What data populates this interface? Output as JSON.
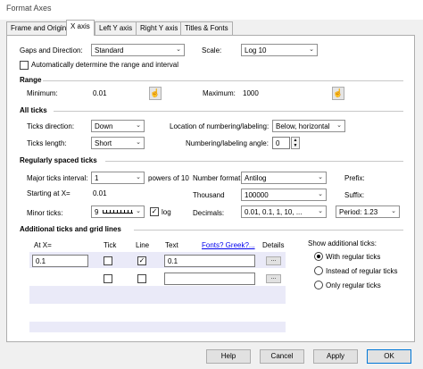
{
  "window": {
    "title": "Format Axes"
  },
  "tabs": [
    "Frame and Origin",
    "X axis",
    "Left Y axis",
    "Right Y axis",
    "Titles & Fonts"
  ],
  "gaps": {
    "label": "Gaps and Direction:",
    "value": "Standard",
    "scale_label": "Scale:",
    "scale_value": "Log 10",
    "auto_label": "Automatically determine the range and interval"
  },
  "range": {
    "title": "Range",
    "min_label": "Minimum:",
    "min_value": "0.01",
    "max_label": "Maximum:",
    "max_value": "1000"
  },
  "all_ticks": {
    "title": "All ticks",
    "dir_label": "Ticks direction:",
    "dir_value": "Down",
    "loc_label": "Location of numbering/labeling:",
    "loc_value": "Below, horizontal",
    "len_label": "Ticks length:",
    "len_value": "Short",
    "angle_label": "Numbering/labeling angle:",
    "angle_value": "0"
  },
  "regular": {
    "title": "Regularly spaced ticks",
    "major_label": "Major ticks interval:",
    "major_value": "1",
    "powers_label": "powers of 10",
    "numfmt_label": "Number format:",
    "numfmt_value": "Antilog",
    "prefix_label": "Prefix:",
    "start_label": "Starting at X=",
    "start_value": "0.01",
    "thousand_label": "Thousand",
    "thousand_value": "100000",
    "suffix_label": "Suffix:",
    "minor_label": "Minor ticks:",
    "minor_value": "9",
    "log_label": "log",
    "decimals_label": "Decimals:",
    "decimals_value": "0.01, 0.1, 1, 10, ...",
    "period_value": "Period: 1.23"
  },
  "additional": {
    "title": "Additional ticks and grid lines",
    "col_at": "At X=",
    "col_tick": "Tick",
    "col_line": "Line",
    "col_text": "Text",
    "fonts_link": "Fonts? Greek?...",
    "col_details": "Details",
    "rows": [
      {
        "at": "0.1",
        "tick": false,
        "line": true,
        "text": "0.1",
        "details": "..."
      },
      {
        "at": "",
        "tick": false,
        "line": false,
        "text": "",
        "details": "..."
      }
    ],
    "show_label": "Show additional ticks:",
    "options": [
      "With regular ticks",
      "Instead of regular ticks",
      "Only regular ticks"
    ],
    "selected": "With regular ticks"
  },
  "buttons": {
    "help": "Help",
    "cancel": "Cancel",
    "apply": "Apply",
    "ok": "OK"
  },
  "icons": {
    "range_btn": "hand-icon",
    "spin": "spinner-icon",
    "dropdown": "chevron-down-icon"
  }
}
